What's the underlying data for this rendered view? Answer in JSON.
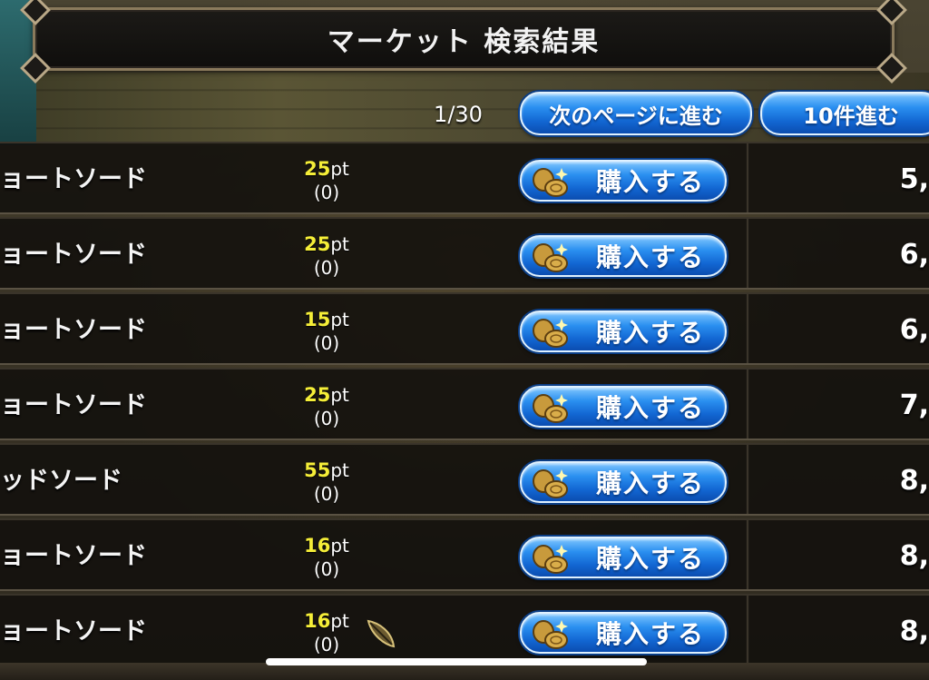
{
  "header": {
    "title": "マーケット 検索結果"
  },
  "pager": {
    "page_indicator": "1/30",
    "next_page_label": "次のページに進む",
    "skip10_label": "10件進む"
  },
  "colors": {
    "button_blue": "#1266d2",
    "price_yellow": "#f5ee38",
    "row_background": "#12100d"
  },
  "listings": [
    {
      "name": "ョートソード",
      "price": "25",
      "unit": "pt",
      "count": "(0)",
      "buy_label": "購入する",
      "value": "5,",
      "icon": "coin-icon"
    },
    {
      "name": "ョートソード",
      "price": "25",
      "unit": "pt",
      "count": "(0)",
      "buy_label": "購入する",
      "value": "6,",
      "icon": "coin-icon"
    },
    {
      "name": "ョートソード",
      "price": "15",
      "unit": "pt",
      "count": "(0)",
      "buy_label": "購入する",
      "value": "6,",
      "icon": "coin-icon"
    },
    {
      "name": "ョートソード",
      "price": "25",
      "unit": "pt",
      "count": "(0)",
      "buy_label": "購入する",
      "value": "7,",
      "icon": "coin-icon"
    },
    {
      "name": "ッドソード",
      "price": "55",
      "unit": "pt",
      "count": "(0)",
      "buy_label": "購入する",
      "value": "8,",
      "icon": "coin-icon"
    },
    {
      "name": "ョートソード",
      "price": "16",
      "unit": "pt",
      "count": "(0)",
      "buy_label": "購入する",
      "value": "8,",
      "icon": "coin-icon"
    },
    {
      "name": "ョートソード",
      "price": "16",
      "unit": "pt",
      "count": "(0)",
      "buy_label": "購入する",
      "value": "8,",
      "icon": "coin-icon"
    }
  ]
}
